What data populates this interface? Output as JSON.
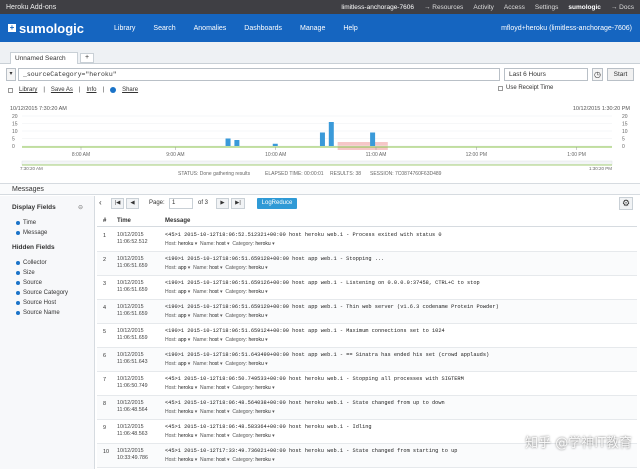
{
  "topbar": {
    "brand": "Heroku Add-ons",
    "app": "limitless-anchorage-7606",
    "links": [
      "→ Resources",
      "Activity",
      "Access",
      "Settings"
    ],
    "sumo": "sumologic",
    "docs": "→ Docs"
  },
  "nav": {
    "logo": "sumologic",
    "items": [
      "Library",
      "Search",
      "Anomalies",
      "Dashboards",
      "Manage",
      "Help"
    ],
    "user": "mfloyd+heroku (limitless-anchorage-7606)"
  },
  "tabs": {
    "active": "Unnamed Search",
    "add": "+"
  },
  "query": {
    "text": "_sourceCategory=\"heroku\"",
    "time_range": "Last 6 Hours",
    "start": "Start",
    "links": [
      "Library",
      "Save As",
      "Info",
      "Share"
    ],
    "receipt_label": "Use Receipt Time"
  },
  "histogram": {
    "start": "10/12/2015 7:30:20 AM",
    "end": "10/12/2015 1:30:20 PM",
    "y_ticks": [
      "20",
      "15",
      "10",
      "5",
      "0"
    ],
    "x_ticks": [
      "8:00 AM",
      "9:00 AM",
      "10:00 AM",
      "11:00 AM",
      "12:00 PM",
      "1:00 PM"
    ],
    "axis_start": "7:30:20 AM",
    "axis_end": "1:30:20 PM",
    "bars": [
      {
        "t": 0.345,
        "v": 5
      },
      {
        "t": 0.36,
        "v": 4
      },
      {
        "t": 0.425,
        "v": 1.5
      },
      {
        "t": 0.505,
        "v": 9
      },
      {
        "t": 0.52,
        "v": 16
      },
      {
        "t": 0.59,
        "v": 9
      }
    ],
    "color": "#3a9ad9",
    "highlight_color": "#f6c7c7"
  },
  "status": {
    "status": "STATUS:  Done gathering results",
    "elapsed": "ELAPSED TIME:  00:00:01",
    "results": "RESULTS:  38",
    "session": "SESSION:  7C0874760F63D489"
  },
  "messages": {
    "title": "Messages",
    "display_fields_title": "Display Fields",
    "display_fields": [
      "Time",
      "Message"
    ],
    "hidden_fields_title": "Hidden Fields",
    "hidden_fields": [
      "Collector",
      "Size",
      "Source",
      "Source Category",
      "Source Host",
      "Source Name"
    ],
    "page_label": "Page:",
    "page": "1",
    "of": "of 3",
    "logreduce": "LogReduce",
    "col_num": "#",
    "col_time": "Time",
    "col_msg": "Message",
    "rows": [
      {
        "n": "1",
        "date": "10/12/2015",
        "time": "11:06:52.512",
        "msg": "<45>1 2015-10-12T18:06:52.512321+00:00 host heroku web.1 - Process exited with status 0",
        "host": "heroku",
        "name": "host",
        "cat": "heroku"
      },
      {
        "n": "2",
        "date": "10/12/2015",
        "time": "11:06:51.659",
        "msg": "<190>1 2015-10-12T18:06:51.659128+00:00 host app web.1 - Stopping ...",
        "host": "app",
        "name": "host",
        "cat": "heroku"
      },
      {
        "n": "3",
        "date": "10/12/2015",
        "time": "11:06:51.659",
        "msg": "<190>1 2015-10-12T18:06:51.659126+00:00 host app web.1 - Listening on 0.0.0.0:37458, CTRL+C to stop",
        "host": "app",
        "name": "host",
        "cat": "heroku"
      },
      {
        "n": "4",
        "date": "10/12/2015",
        "time": "11:06:51.659",
        "msg": "<190>1 2015-10-12T18:06:51.659120+00:00 host app web.1 - Thin web server (v1.6.3 codename Protein Powder)",
        "host": "app",
        "name": "host",
        "cat": "heroku"
      },
      {
        "n": "5",
        "date": "10/12/2015",
        "time": "11:06:51.659",
        "msg": "<190>1 2015-10-12T18:06:51.659124+00:00 host app web.1 - Maximum connections set to 1024",
        "host": "app",
        "name": "host",
        "cat": "heroku"
      },
      {
        "n": "6",
        "date": "10/12/2015",
        "time": "11:06:51.643",
        "msg": "<190>1 2015-10-12T18:06:51.643499+00:00 host app web.1 - == Sinatra has ended his set (crowd applauds)",
        "host": "app",
        "name": "host",
        "cat": "heroku"
      },
      {
        "n": "7",
        "date": "10/12/2015",
        "time": "11:06:50.749",
        "msg": "<45>1 2015-10-12T18:06:50.749533+00:00 host heroku web.1 - Stopping all processes with SIGTERM",
        "host": "heroku",
        "name": "host",
        "cat": "heroku"
      },
      {
        "n": "8",
        "date": "10/12/2015",
        "time": "11:06:48.564",
        "msg": "<45>1 2015-10-12T18:06:48.564038+00:00 host heroku web.1 - State changed from up to down",
        "host": "heroku",
        "name": "host",
        "cat": "heroku"
      },
      {
        "n": "9",
        "date": "10/12/2015",
        "time": "11:06:48.563",
        "msg": "<45>1 2015-10-12T18:06:48.583364+00:00 host heroku web.1 - Idling",
        "host": "heroku",
        "name": "host",
        "cat": "heroku"
      },
      {
        "n": "10",
        "date": "10/12/2015",
        "time": "10:33:49.786",
        "msg": "<45>1 2015-10-12T17:33:49.736021+00:00 host heroku web.1 - State changed from starting to up",
        "host": "heroku",
        "name": "host",
        "cat": "heroku"
      }
    ]
  },
  "meta_labels": {
    "host": "Host:",
    "name": "Name:",
    "cat": "Category:"
  },
  "watermark": "知乎 @学神IT教育"
}
